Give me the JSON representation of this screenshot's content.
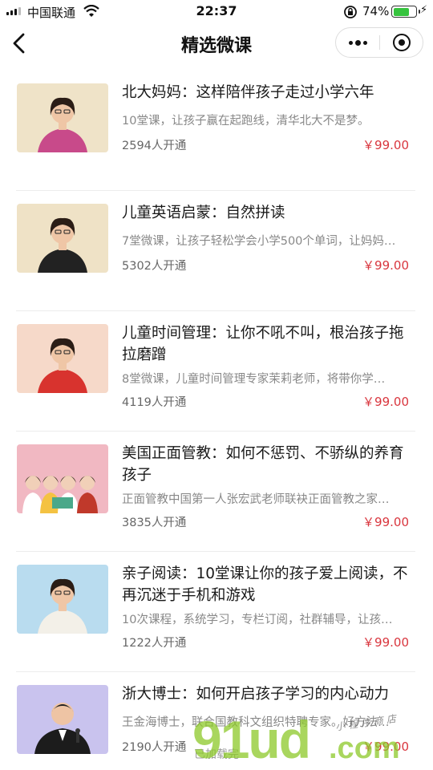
{
  "status_bar": {
    "carrier": "中国联通",
    "time": "22:37",
    "battery_percent": "74%",
    "battery_level": 0.74,
    "icons": [
      "signal-icon",
      "wifi-icon",
      "orientation-lock-icon",
      "battery-icon",
      "charging-icon"
    ]
  },
  "nav": {
    "title": "精选微课",
    "back_icon": "chevron-left-icon",
    "menu_icon": "more-dots-icon",
    "close_icon": "target-circle-icon"
  },
  "colors": {
    "price": "#d9363e",
    "battery": "#36c33e",
    "watermark": "#8cc828"
  },
  "courses": [
    {
      "title": "北大妈妈：这样陪伴孩子走过小学六年",
      "desc": "10堂课，让孩子赢在起跑线，清华北大不是梦。",
      "subscribers": "2594人开通",
      "price": "￥99.00",
      "thumb_bg": "#efe3c8",
      "thumb_dress": "#c84a8a",
      "thumb_kind": "single"
    },
    {
      "title": "儿童英语启蒙：自然拼读",
      "desc": "7堂微课，让孩子轻松学会小学500个单词，让妈妈…",
      "subscribers": "5302人开通",
      "price": "￥99.00",
      "thumb_bg": "#efe2c6",
      "thumb_dress": "#222222",
      "thumb_kind": "single"
    },
    {
      "title": "儿童时间管理：让你不吼不叫，根治孩子拖拉磨蹭",
      "desc": "8堂微课，儿童时间管理专家茉莉老师，将带你学…",
      "subscribers": "4119人开通",
      "price": "￥99.00",
      "thumb_bg": "#f6d9c9",
      "thumb_dress": "#d8332e",
      "thumb_kind": "single"
    },
    {
      "title": "美国正面管教：如何不惩罚、不骄纵的养育孩子",
      "desc": "正面管教中国第一人张宏武老师联袂正面管教之家…",
      "subscribers": "3835人开通",
      "price": "￥99.00",
      "thumb_bg": "#f1b8c2",
      "thumb_dress": "#ffffff",
      "thumb_kind": "group"
    },
    {
      "title": "亲子阅读：10堂课让你的孩子爱上阅读，不再沉迷于手机和游戏",
      "desc": "10次课程，系统学习，专栏订阅，社群辅导，让孩…",
      "subscribers": "1222人开通",
      "price": "￥99.00",
      "thumb_bg": "#b9dcef",
      "thumb_dress": "#f3f0e8",
      "thumb_kind": "single"
    },
    {
      "title": "浙大博士：如何开启孩子学习的内心动力",
      "desc": "王金海博士，联合国教科文组织特聘专家。好方法…",
      "subscribers": "2190人开通",
      "price": "￥99.00",
      "thumb_bg": "#c9c3ee",
      "thumb_dress": "#1c1c1c",
      "thumb_kind": "speaker"
    }
  ],
  "footer": {
    "loaded_text": "已加载完"
  },
  "watermark": {
    "main": "91ud",
    "domain": ".com",
    "tagline": "小程序商店"
  }
}
